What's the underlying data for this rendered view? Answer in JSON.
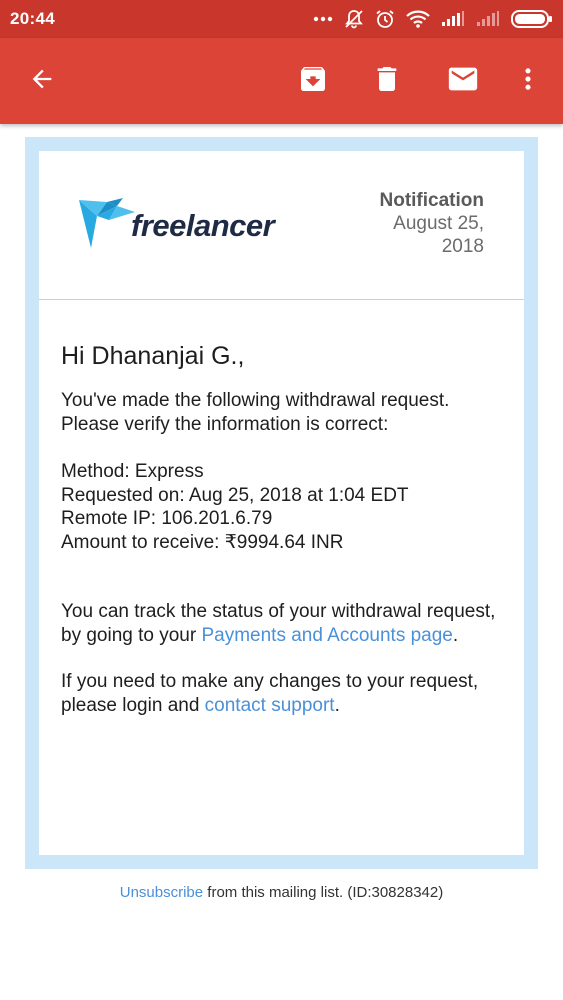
{
  "status_bar": {
    "time": "20:44",
    "icons": [
      "more-dots-icon",
      "notifications-off-icon",
      "alarm-icon",
      "wifi-icon",
      "signal-icon",
      "signal-weak-icon",
      "battery-icon"
    ]
  },
  "app_bar": {
    "icons": [
      "back-arrow-icon",
      "archive-icon",
      "delete-icon",
      "mail-icon",
      "more-vert-icon"
    ],
    "color": "#db4437"
  },
  "email": {
    "logo_text": "freelancer",
    "notification_label": "Notification",
    "date_line1": "August 25,",
    "date_line2": "2018",
    "greeting": "Hi Dhananjai G.,",
    "intro": "You've made the following withdrawal request. Please verify the information is correct:",
    "method": "Method: Express",
    "requested_on": "Requested on: Aug 25, 2018 at 1:04 EDT",
    "remote_ip": "Remote IP: 106.201.6.79",
    "amount": "Amount to receive: ₹9994.64 INR",
    "track_text": "You can track the status of your withdrawal request, by going to your ",
    "track_link": "Payments and Accounts page",
    "track_end": ".",
    "changes_text": "If you need to make any changes to your request, please login and ",
    "changes_link": "contact support",
    "changes_end": "."
  },
  "footer": {
    "unsubscribe_link": "Unsubscribe",
    "rest": " from this mailing list. (ID:30828342)"
  },
  "colors": {
    "status_bar": "#c9372c",
    "link": "#4a90d9",
    "frame": "#cbe6f8",
    "logo_blue": "#29a9e1"
  }
}
